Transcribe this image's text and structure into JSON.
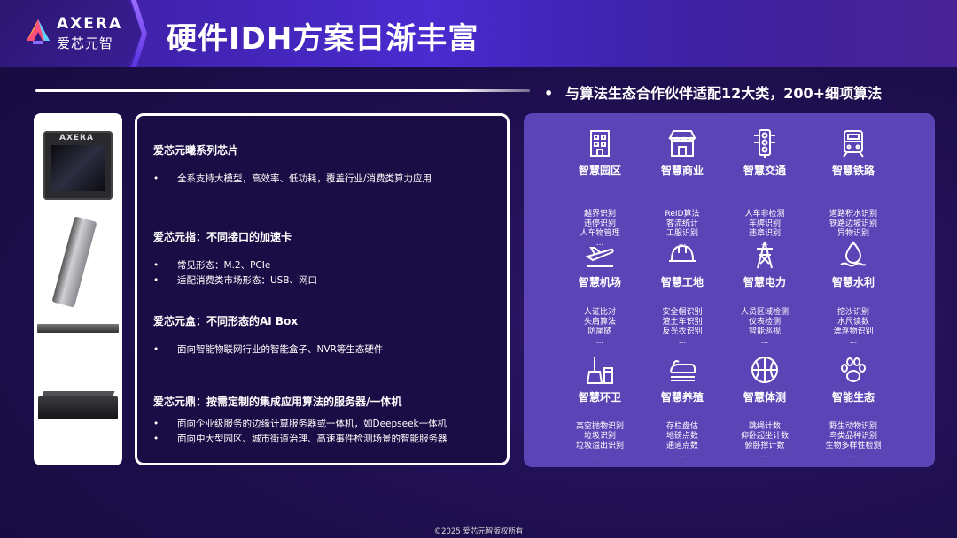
{
  "logo": {
    "brand": "AXERA",
    "sub": "爱芯元智"
  },
  "title": "硬件IDH方案日渐丰富",
  "subtitle": {
    "bullet": "•",
    "text": "与算法生态合作伙伴适配12大类，200+细项算法"
  },
  "products": {
    "chip_brand": "AXERA"
  },
  "sections": [
    {
      "title": "爱芯元曦系列芯片",
      "items": [
        "全系支持大模型，高效率、低功耗，覆盖行业/消费类算力应用"
      ]
    },
    {
      "title": "爱芯元指：不同接口的加速卡",
      "items": [
        "常见形态：M.2、PCIe",
        "适配消费类市场形态：USB、网口"
      ]
    },
    {
      "title": "爱芯元盒：不同形态的AI Box",
      "items": [
        "面向智能物联网行业的智能盒子、NVR等生态硬件"
      ]
    },
    {
      "title": "爱芯元鼎：按需定制的集成应用算法的服务器/一体机",
      "items": [
        "面向企业级服务的边缘计算服务器或一体机，如Deepseek一体机",
        "面向中大型园区、城市街道治理、高速事件检测场景的智能服务器"
      ]
    }
  ],
  "bullet": "•",
  "categories": [
    {
      "icon": "building-icon",
      "name": "智慧园区",
      "items": [
        "越界识别",
        "违停识别",
        "人车物管理",
        "..."
      ]
    },
    {
      "icon": "store-icon",
      "name": "智慧商业",
      "items": [
        "ReID算法",
        "客流统计",
        "工服识别",
        "..."
      ]
    },
    {
      "icon": "traffic-light-icon",
      "name": "智慧交通",
      "items": [
        "人车非检测",
        "车牌识别",
        "违章识别",
        "..."
      ]
    },
    {
      "icon": "train-icon",
      "name": "智慧铁路",
      "items": [
        "道路积水识别",
        "铁路边坡识别",
        "异物识别",
        "..."
      ]
    },
    {
      "icon": "airplane-icon",
      "name": "智慧机场",
      "items": [
        "人证比对",
        "头肩算法",
        "防尾随",
        "..."
      ]
    },
    {
      "icon": "hardhat-icon",
      "name": "智慧工地",
      "items": [
        "安全帽识别",
        "渣土车识别",
        "反光衣识别",
        "..."
      ]
    },
    {
      "icon": "power-tower-icon",
      "name": "智慧电力",
      "items": [
        "人员区域检测",
        "仪表检测",
        "智能巡视",
        "..."
      ]
    },
    {
      "icon": "water-icon",
      "name": "智慧水利",
      "items": [
        "挖沙识别",
        "水尺读数",
        "漂浮物识别",
        "..."
      ]
    },
    {
      "icon": "broom-icon",
      "name": "智慧环卫",
      "items": [
        "高空抛物识别",
        "垃圾识别",
        "垃圾溢出识别",
        "..."
      ]
    },
    {
      "icon": "livestock-icon",
      "name": "智慧养殖",
      "items": [
        "存栏盘估",
        "地磅点数",
        "通道点数",
        "..."
      ]
    },
    {
      "icon": "basketball-icon",
      "name": "智慧体测",
      "items": [
        "跳绳计数",
        "仰卧起坐计数",
        "俯卧撑计数",
        "..."
      ]
    },
    {
      "icon": "paw-icon",
      "name": "智能生态",
      "items": [
        "野生动物识别",
        "鸟类品种识别",
        "生物多样性检测",
        "..."
      ]
    }
  ],
  "footer": "©2025  爱芯元智版权所有"
}
